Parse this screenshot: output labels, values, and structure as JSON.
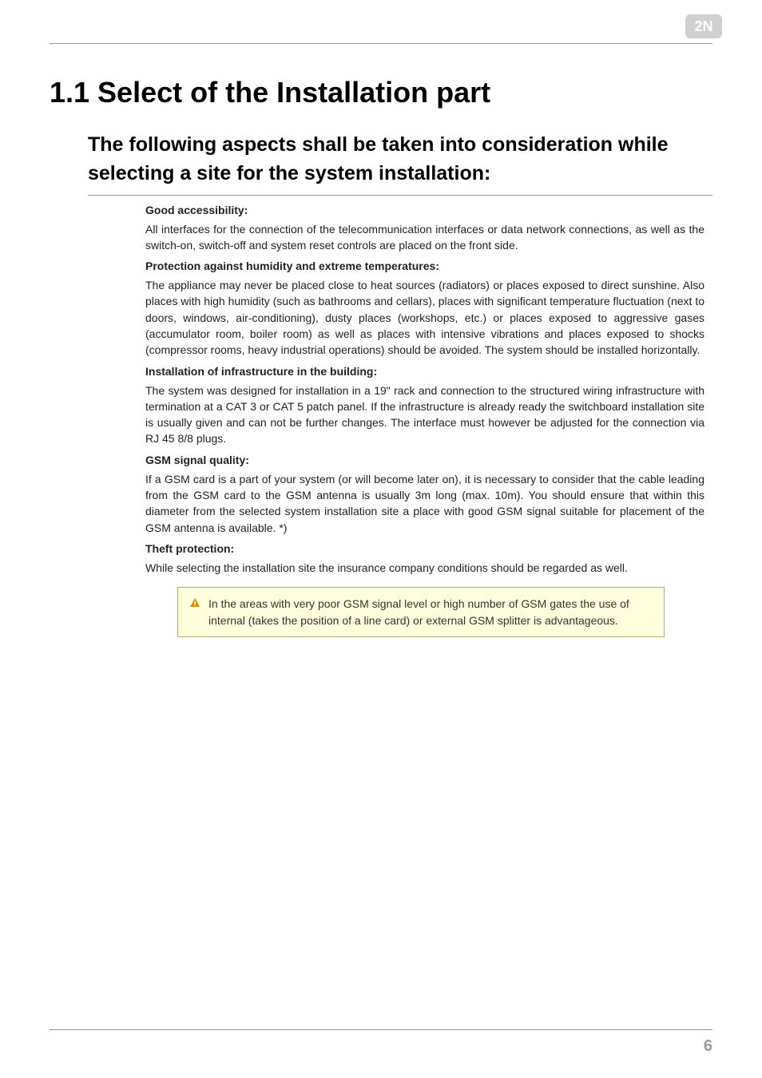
{
  "page_number": "6",
  "main_title": "1.1 Select of the Installation part",
  "sub_title": "The following aspects shall be taken into consideration while selecting a site for the system installation:",
  "sections": {
    "s1": {
      "heading": "Good accessibility:",
      "body": "All interfaces for the connection of the telecommunication interfaces or data network connections, as well as the switch-on, switch-off and system reset controls are placed on the front side."
    },
    "s2": {
      "heading": "Protection against humidity and extreme temperatures:",
      "body": "The appliance may never be placed close to heat sources (radiators) or places exposed to direct sunshine. Also places with high humidity (such as bathrooms and cellars), places with significant temperature fluctuation (next to doors, windows, air-conditioning), dusty places (workshops, etc.) or places exposed to aggressive gases (accumulator room, boiler room) as well as places with intensive vibrations and places exposed to shocks (compressor rooms, heavy industrial operations) should be avoided. The system should be installed horizontally."
    },
    "s3": {
      "heading": "Installation of infrastructure in the building:",
      "body": "The system was designed for installation in a 19\" rack and connection to the structured wiring infrastructure with termination at a CAT 3 or CAT 5 patch panel. If the infrastructure is already ready the switchboard installation site is usually given and can not be further changes. The interface must however be adjusted for the connection via RJ 45 8/8 plugs."
    },
    "s4": {
      "heading": "GSM signal quality:",
      "body": "If a GSM card is a part of your system (or will become later on), it is necessary to consider that the cable leading from the GSM card to the GSM antenna is usually 3m long (max. 10m). You should ensure that within this diameter from the selected system installation site a place with good GSM signal suitable for placement of the GSM antenna is available. *)"
    },
    "s5": {
      "heading": "Theft protection:",
      "body": "While selecting the installation site the insurance company conditions should be regarded as well."
    }
  },
  "callout": {
    "text": "In the areas with very poor GSM signal level or high number of GSM gates the use of internal (takes the position of a line card) or external GSM splitter is advantageous."
  }
}
